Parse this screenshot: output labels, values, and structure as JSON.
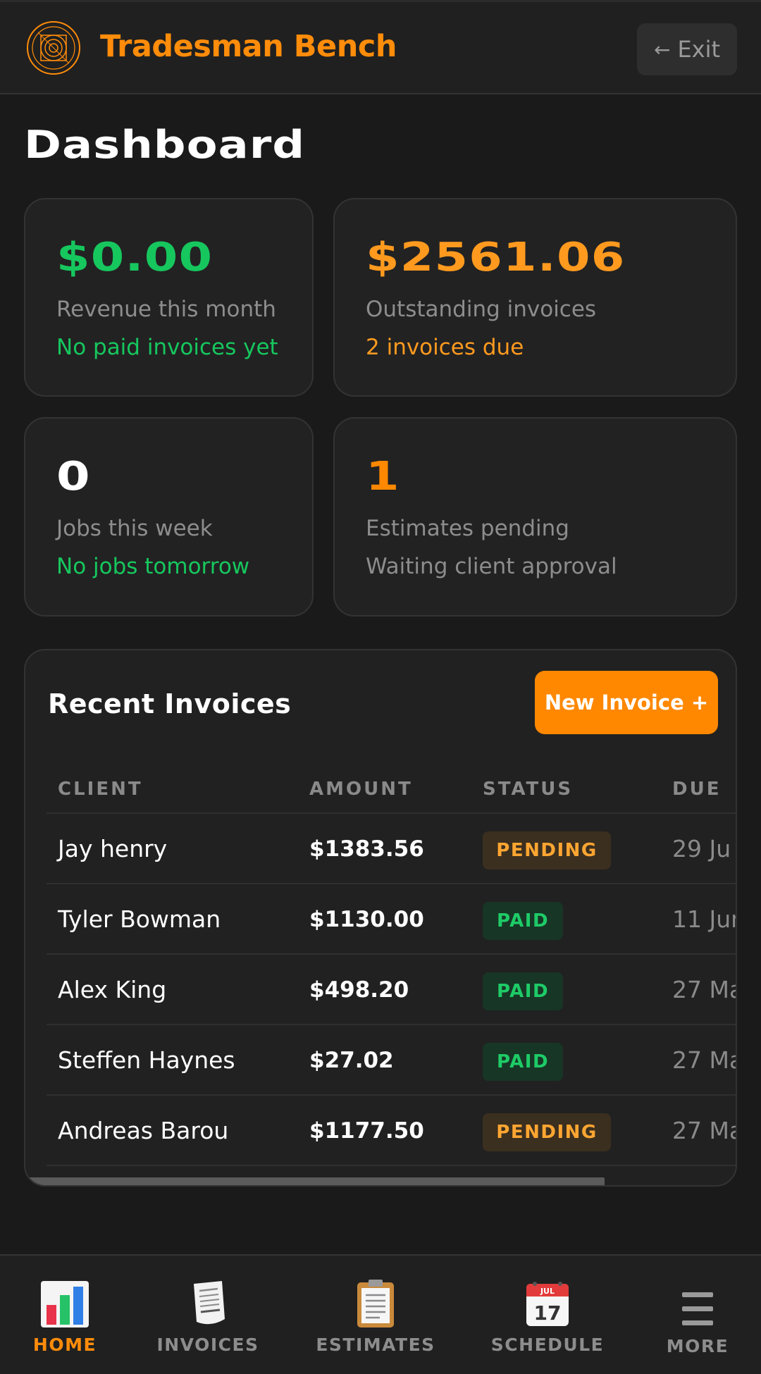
{
  "header": {
    "brand": "Tradesman Bench",
    "exit_label": "Exit",
    "exit_icon": "arrow-left-icon"
  },
  "page": {
    "title": "Dashboard"
  },
  "stats": {
    "revenue": {
      "value": "$0.00",
      "label": "Revenue this month",
      "sub": "No paid invoices yet"
    },
    "outstanding": {
      "value": "$2561.06",
      "label": "Outstanding invoices",
      "sub": "2 invoices due"
    },
    "jobs": {
      "value": "0",
      "label": "Jobs this week",
      "sub": "No jobs tomorrow"
    },
    "estimates": {
      "value": "1",
      "label": "Estimates pending",
      "sub": "Waiting client approval"
    }
  },
  "invoices": {
    "title": "Recent Invoices",
    "new_button": "New Invoice +",
    "columns": [
      "CLIENT",
      "AMOUNT",
      "STATUS",
      "DUE"
    ],
    "rows": [
      {
        "client": "Jay henry",
        "amount": "$1383.56",
        "status": "PENDING",
        "due": "29 Ju"
      },
      {
        "client": "Tyler Bowman",
        "amount": "$1130.00",
        "status": "PAID",
        "due": "11 Jun"
      },
      {
        "client": "Alex King",
        "amount": "$498.20",
        "status": "PAID",
        "due": "27 Ma"
      },
      {
        "client": "Steffen Haynes",
        "amount": "$27.02",
        "status": "PAID",
        "due": "27 Ma"
      },
      {
        "client": "Andreas Barou",
        "amount": "$1177.50",
        "status": "PENDING",
        "due": "27 Ma"
      }
    ]
  },
  "nav": {
    "items": [
      {
        "label": "HOME",
        "icon": "bar-chart-icon",
        "active": true
      },
      {
        "label": "INVOICES",
        "icon": "receipt-icon",
        "active": false
      },
      {
        "label": "ESTIMATES",
        "icon": "clipboard-icon",
        "active": false
      },
      {
        "label": "SCHEDULE",
        "icon": "calendar-icon",
        "active": false,
        "calendar_month": "JUL",
        "calendar_day": "17"
      },
      {
        "label": "MORE",
        "icon": "menu-icon",
        "active": false
      }
    ]
  },
  "colors": {
    "accent": "#ff8c0a",
    "positive": "#16c75e",
    "warning": "#ff9a1f",
    "background": "#1a1a1a",
    "card": "#222222"
  }
}
